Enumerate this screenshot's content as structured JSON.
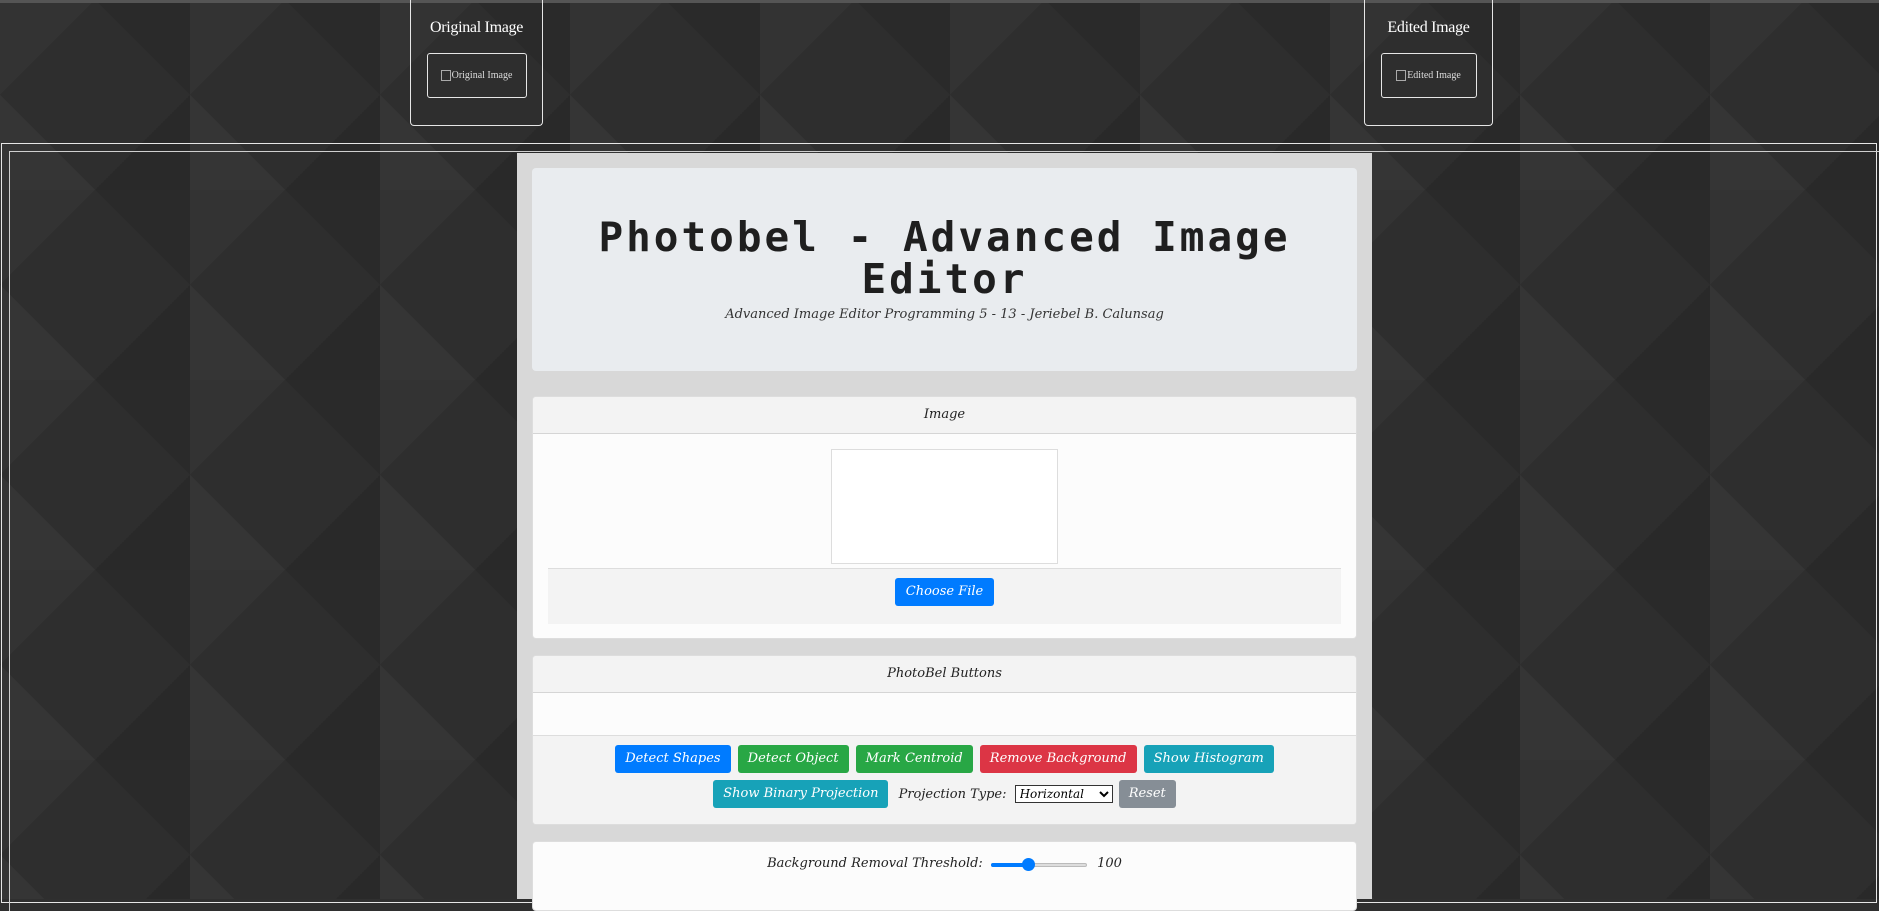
{
  "thumbs": {
    "original_title": "Original Image",
    "original_alt": "Original Image",
    "edited_title": "Edited Image",
    "edited_alt": "Edited Image"
  },
  "header": {
    "title": "Photobel - Advanced Image Editor",
    "subtitle": "Advanced Image Editor Programming 5 - 13 - Jeriebel B. Calunsag"
  },
  "image_card": {
    "header": "Image",
    "choose_file": "Choose File"
  },
  "buttons_card": {
    "header": "PhotoBel Buttons",
    "detect_shapes": "Detect Shapes",
    "detect_object": "Detect Object",
    "mark_centroid": "Mark Centroid",
    "remove_background": "Remove Background",
    "show_histogram": "Show Histogram",
    "show_binary_projection": "Show Binary Projection",
    "projection_label": "Projection Type:",
    "projection_selected": "Horizontal",
    "reset": "Reset"
  },
  "threshold": {
    "label": "Background Removal Threshold:",
    "value": "100",
    "fraction": 0.39
  },
  "colors": {
    "primary": "#007bff",
    "success": "#28a745",
    "danger": "#dc3545",
    "info": "#17a2b8",
    "secondary": "#868e96"
  }
}
